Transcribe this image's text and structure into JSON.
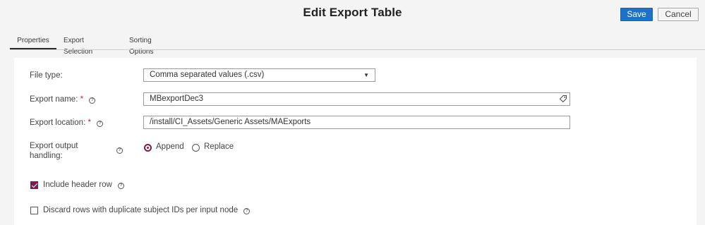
{
  "header": {
    "title": "Edit Export Table",
    "save_label": "Save",
    "cancel_label": "Cancel",
    "accent_color": "#1d71c9"
  },
  "tabs": [
    {
      "label": "Properties",
      "active": true
    },
    {
      "label": "Export Selection",
      "active": false
    },
    {
      "label": "Sorting Options",
      "active": false
    }
  ],
  "form": {
    "file_type": {
      "label": "File type:",
      "value": "Comma separated values (.csv)",
      "icon": "chevron-down-icon"
    },
    "export_name": {
      "label": "Export name:",
      "required_mark": "*",
      "value": "MBexportDec3",
      "icon": "tag-icon"
    },
    "export_location": {
      "label": "Export location:",
      "required_mark": "*",
      "value": "/install/CI_Assets/Generic Assets/MAExports"
    },
    "output_handling": {
      "label_line1": "Export output",
      "label_line2": "handling:",
      "options": [
        {
          "label": "Append",
          "selected": true
        },
        {
          "label": "Replace",
          "selected": false
        }
      ]
    },
    "include_header": {
      "label": "Include header row",
      "checked": true
    },
    "discard_duplicates": {
      "label": "Discard rows with duplicate subject IDs per input node",
      "checked": false
    },
    "check_color": "#7a1f47"
  }
}
